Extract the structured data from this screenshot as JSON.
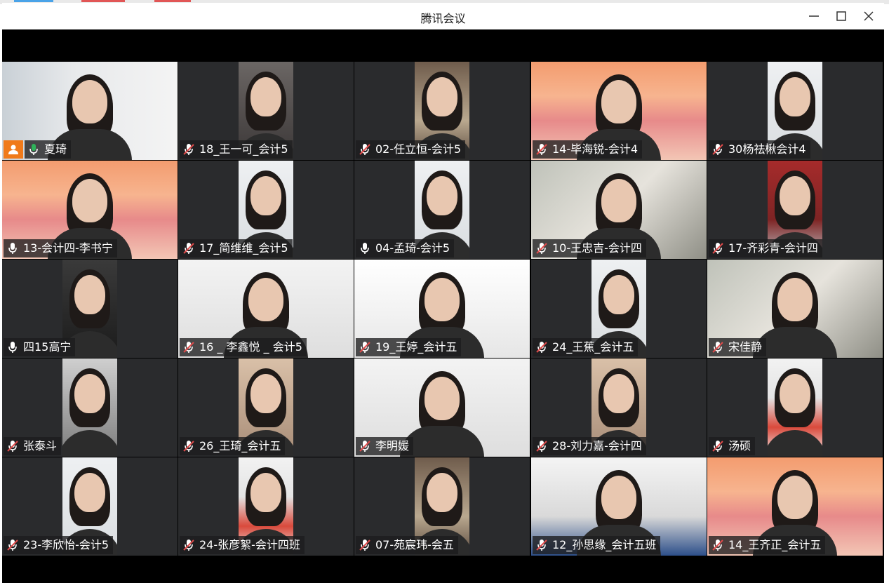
{
  "window": {
    "title": "腾讯会议"
  },
  "titlebar_controls": [
    "minimize-icon",
    "maximize-icon",
    "close-icon"
  ],
  "colors": {
    "active_border": "#2fb35a",
    "host_badge": "#f07a1a",
    "mic_on": "#2fb35a",
    "mic_muted": "#e04b4b"
  },
  "participants": [
    {
      "name": "夏琦",
      "mic": "on",
      "active": true,
      "host": true,
      "video": "full",
      "bg": "office"
    },
    {
      "name": "18_王一可_会计5",
      "mic": "muted",
      "video": "center",
      "bg": "room"
    },
    {
      "name": "02-任立恒-会计5",
      "mic": "muted",
      "video": "center",
      "bg": "shelf"
    },
    {
      "name": "14-毕海锐-会计4",
      "mic": "muted",
      "video": "full",
      "bg": "mountain"
    },
    {
      "name": "30杨祛楸会计4",
      "mic": "muted",
      "video": "center",
      "bg": "light"
    },
    {
      "name": "13-会计四-李书宁",
      "mic": "idle",
      "video": "full",
      "bg": "mountain"
    },
    {
      "name": "17_简维维_会计5",
      "mic": "muted",
      "video": "center",
      "bg": "light"
    },
    {
      "name": "04-孟琦-会计5",
      "mic": "idle",
      "video": "center",
      "bg": "light"
    },
    {
      "name": "10-王忠吉-会计四",
      "mic": "muted",
      "video": "full",
      "bg": "blur"
    },
    {
      "name": "17-齐彩青-会计四",
      "mic": "muted",
      "video": "center",
      "bg": "redroom"
    },
    {
      "name": "四15高宁",
      "mic": "idle",
      "video": "center",
      "bg": "dark"
    },
    {
      "name": "16 _ 李鑫悦 _ 会计5",
      "mic": "muted",
      "video": "full",
      "bg": "wall"
    },
    {
      "name": "19_王婷_会计五",
      "mic": "muted",
      "video": "full",
      "bg": "building"
    },
    {
      "name": "24_王蕉_会计五",
      "mic": "muted",
      "video": "center",
      "bg": "light"
    },
    {
      "name": "宋佳静",
      "mic": "muted",
      "video": "full",
      "bg": "blur"
    },
    {
      "name": "张泰斗",
      "mic": "muted",
      "video": "center",
      "bg": "dim"
    },
    {
      "name": "26_王琦_会计五",
      "mic": "muted",
      "video": "center",
      "bg": "warm"
    },
    {
      "name": "李明媛",
      "mic": "muted",
      "video": "full",
      "bg": "wall"
    },
    {
      "name": "28-刘力嘉-会计四",
      "mic": "muted",
      "video": "center",
      "bg": "warm"
    },
    {
      "name": "汤硕",
      "mic": "muted",
      "video": "center",
      "bg": "red"
    },
    {
      "name": "23-李欣怡-会计5",
      "mic": "muted",
      "video": "center",
      "bg": "light"
    },
    {
      "name": "24-张彦絮-会计四班",
      "mic": "muted",
      "video": "center",
      "bg": "red"
    },
    {
      "name": "07-苑宸玮-会五",
      "mic": "muted",
      "video": "center",
      "bg": "shelf"
    },
    {
      "name": "12_孙思缘_会计五班",
      "mic": "muted",
      "video": "full",
      "bg": "officeroom"
    },
    {
      "name": "14_王齐正_会计五",
      "mic": "muted",
      "video": "full",
      "bg": "mountain"
    }
  ]
}
